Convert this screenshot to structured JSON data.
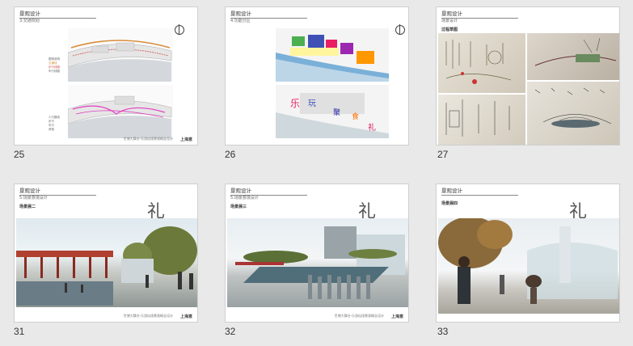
{
  "slides": [
    {
      "number": "25",
      "header": "景观设计",
      "subheader": "3.交通规划",
      "footer": "世博大舞台·乐游仙境景观概念设计",
      "logo": "上海意"
    },
    {
      "number": "26",
      "header": "景观设计",
      "subheader": "4.功能分区",
      "footer": "",
      "logo": "",
      "zones": [
        "乐",
        "玩",
        "聚",
        "食",
        "礼"
      ]
    },
    {
      "number": "27",
      "header": "景观设计",
      "subheader": "场景设计",
      "section": "过程草图",
      "footer": "",
      "logo": ""
    },
    {
      "number": "31",
      "header": "景观设计",
      "subheader": "5.场景意境设计",
      "section": "场景展二",
      "char": "礼",
      "footer": "世博大舞台·乐游仙境景观概念设计",
      "logo": "上海意"
    },
    {
      "number": "32",
      "header": "景观设计",
      "subheader": "5.场景意境设计",
      "section": "场景展三",
      "char": "礼",
      "footer": "世博大舞台·乐游仙境景观概念设计",
      "logo": "上海意"
    },
    {
      "number": "33",
      "header": "景观设计",
      "subheader": "",
      "section": "场景展四",
      "char": "礼",
      "footer": "世博大舞台·乐游仙境景观概念设计",
      "logo": "上海意"
    }
  ],
  "legend_25": [
    "图例说明",
    "交通线",
    "步行线路",
    "车行线路"
  ],
  "legend_25b": [
    "人行路线",
    "步行",
    "车行",
    "其他"
  ]
}
